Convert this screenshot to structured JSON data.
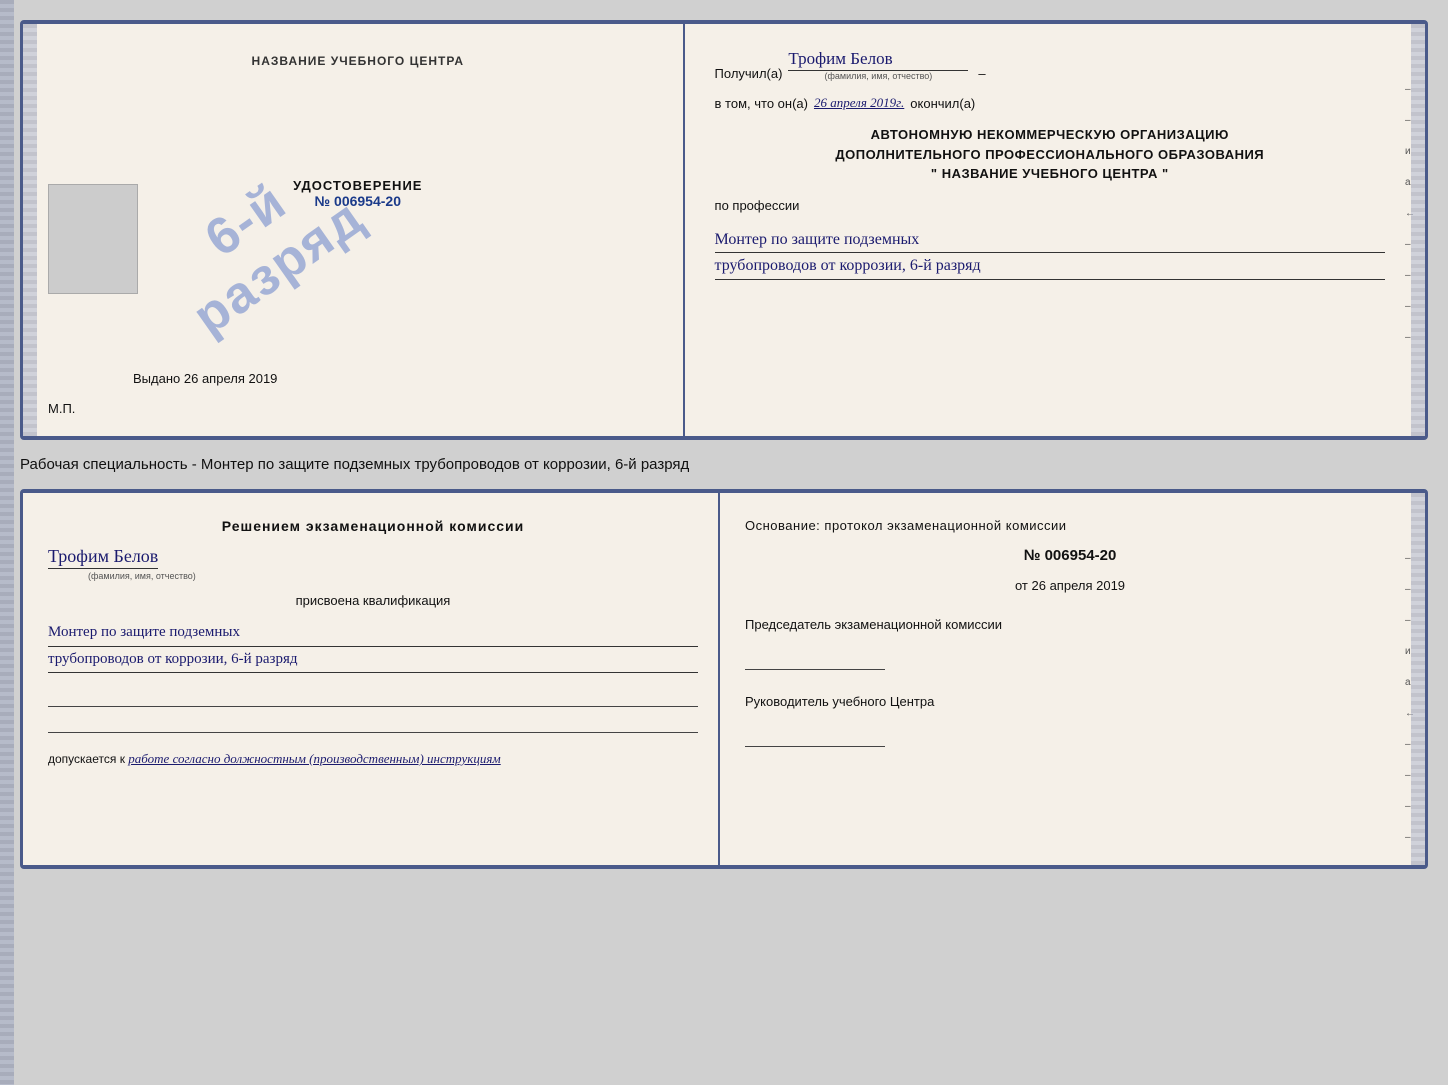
{
  "top_cert": {
    "left": {
      "center_title": "НАЗВАНИЕ УЧЕБНОГО ЦЕНТРА",
      "stamp_line1": "6-й",
      "stamp_line2": "разряд",
      "udostoverenie_label": "УДОСТОВЕРЕНИЕ",
      "udostoverenie_number": "№ 006954-20",
      "vydano_label": "Выдано",
      "vydano_date": "26 апреля 2019",
      "mp_label": "М.П."
    },
    "right": {
      "poluchil_label": "Получил(а)",
      "poluchil_name": "Трофим Белов",
      "poluchil_subtitle": "(фамилия, имя, отчество)",
      "dash": "–",
      "vtom_label": "в том, что он(а)",
      "vtom_date": "26 апреля 2019г.",
      "okonchil_label": "окончил(а)",
      "org_line1": "АВТОНОМНУЮ НЕКОММЕРЧЕСКУЮ ОРГАНИЗАЦИЮ",
      "org_line2": "ДОПОЛНИТЕЛЬНОГО ПРОФЕССИОНАЛЬНОГО ОБРАЗОВАНИЯ",
      "org_line3": "\"   НАЗВАНИЕ УЧЕБНОГО ЦЕНТРА   \"",
      "poprofessii_label": "по профессии",
      "profession_line1": "Монтер по защите подземных",
      "profession_line2": "трубопроводов от коррозии, 6-й разряд",
      "side_marks": [
        "–",
        "–",
        "и",
        "а",
        "←",
        "–",
        "–",
        "–",
        "–"
      ]
    }
  },
  "middle_text": "Рабочая специальность - Монтер по защите подземных трубопроводов от коррозии, 6-й разряд",
  "bottom_cert": {
    "left": {
      "decision_title": "Решением экзаменационной комиссии",
      "name_handwritten": "Трофим Белов",
      "name_subtitle": "(фамилия, имя, отчество)",
      "prisvоena_label": "присвоена квалификация",
      "qualification_line1": "Монтер по защите подземных",
      "qualification_line2": "трубопроводов от коррозии, 6-й разряд",
      "dopuskaetsya_label": "допускается к",
      "dopuskaetsya_italic": "работе согласно должностным (производственным) инструкциям"
    },
    "right": {
      "osnovanie_title": "Основание: протокол экзаменационной комиссии",
      "protocol_number": "№ 006954-20",
      "ot_label": "от",
      "ot_date": "26 апреля 2019",
      "predsedatel_label": "Председатель экзаменационной комиссии",
      "rukovoditel_label": "Руководитель учебного Центра",
      "side_marks": [
        "–",
        "–",
        "–",
        "и",
        "а",
        "←",
        "–",
        "–",
        "–",
        "–"
      ]
    }
  }
}
